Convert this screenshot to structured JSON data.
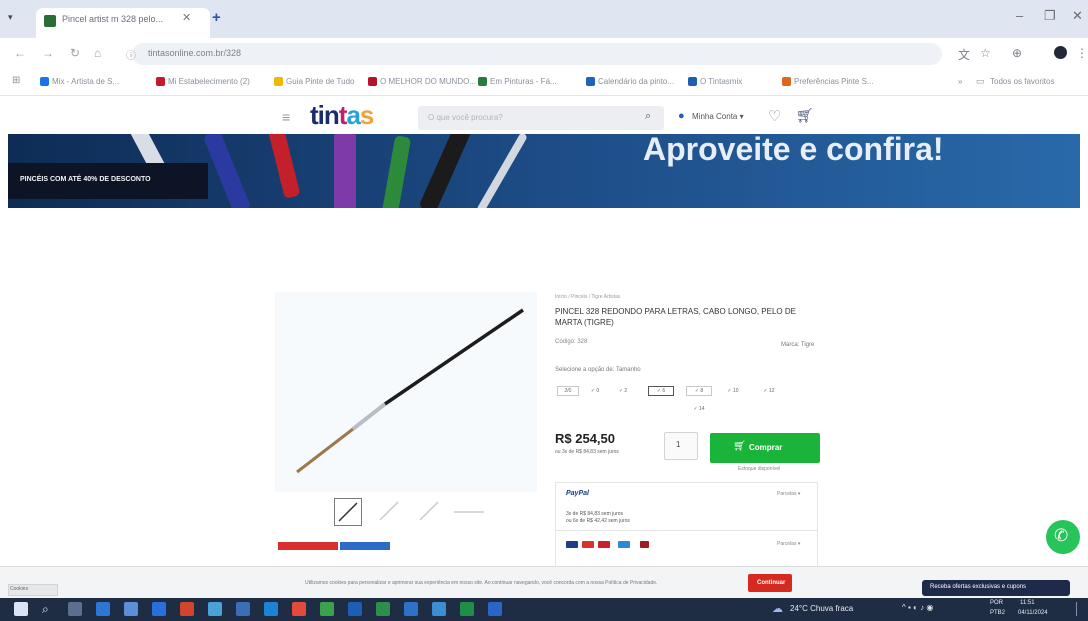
{
  "browser": {
    "tab_title": "Pincel artist m 328 pelo...",
    "tab_close": "✕",
    "new_tab": "+",
    "url": "tintasonline.com.br/328",
    "window_min": "–",
    "window_max": "❐",
    "window_close": "✕"
  },
  "bookmarks": [
    "Mix - Artista de S...",
    "Mi Estabelecimento (2)",
    "Guia Pinte de Tudo",
    "O MELHOR DO MUNDO...",
    "Em Pinturas - Fá...",
    "Calendário da pinto...",
    "O Tintasmix",
    "Preferências Pinte S..."
  ],
  "bookmarks_right": "Todos os favoritos",
  "site": {
    "logo": [
      "tin",
      "t",
      "a",
      "s"
    ],
    "search_placeholder": "O que você procura?",
    "account_label": "Minha Conta ▾"
  },
  "banner": {
    "label": "PINCÉIS COM ATÉ 40% DE DESCONTO",
    "headline": "Aproveite e confira!"
  },
  "product": {
    "breadcrumb": "Início / Pincéis / Tigre Artistas",
    "title": "PINCEL 328 REDONDO PARA LETRAS, CABO LONGO, PELO DE MARTA (TIGRE)",
    "ref": "Código: 328",
    "ref_right": "Marca: Tigre",
    "select_hint": "Selecione a opção de: Tamanho",
    "sizes_row1": [
      "2/0",
      "✓ 0",
      "✓ 2",
      "✓ 6",
      "✓ 8",
      "✓ 10",
      "✓ 12"
    ],
    "sizes_row2": [
      "✓ 14"
    ],
    "price": "R$ 254,50",
    "installments": "ou 3x de R$ 84,83 sem juros",
    "quantity": "1",
    "buy_label": "Comprar",
    "stock_note": "Estoque disponível",
    "payment": {
      "paypal": "PayPal",
      "more": "Parcelas ▾",
      "line1": "3x de R$ 84,83 sem juros",
      "line2": "ou 6x de R$ 42,42 sem juros",
      "more2": "Parcelas ▾"
    }
  },
  "cookie": {
    "tab": "Cookies",
    "text": "Utilizamos cookies para personalizar e aprimorar sua experiência em nosso site. Ao continuar navegando, você concorda com a nossa Política de Privacidade.",
    "button": "Continuar",
    "promo": "Receba ofertas exclusivas e cupons"
  },
  "taskbar": {
    "weather": "24°C  Chuva fraca",
    "lang": "POR",
    "lang2": "PTB2",
    "time": "11:51",
    "date": "04/11/2024"
  },
  "colors": {
    "accent_green": "#1bb43a",
    "whatsapp": "#27c45a",
    "cookie_red": "#d6291f",
    "banner_blue": "#1d4c86"
  }
}
